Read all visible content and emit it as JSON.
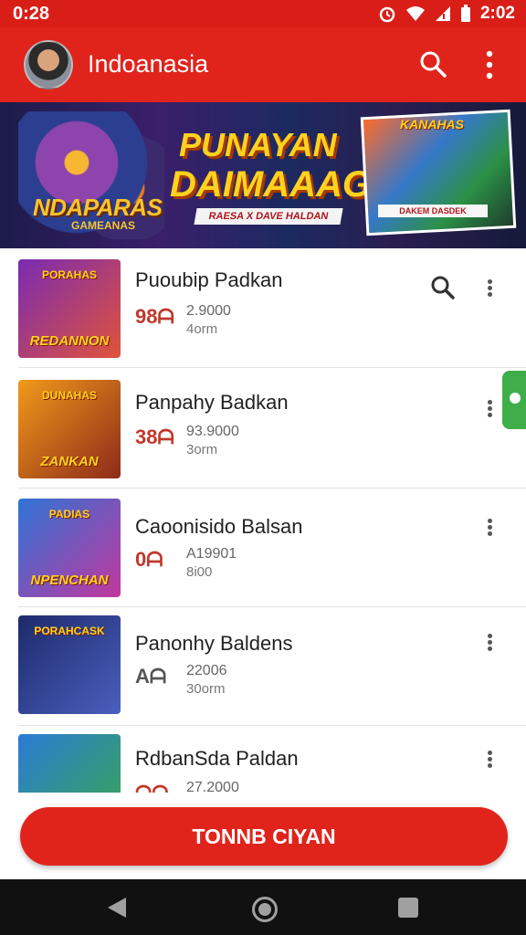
{
  "status_bar": {
    "time": "0:28",
    "battery_time": "2:02"
  },
  "app_bar": {
    "title": "Indoanasia",
    "icons": [
      "avatar",
      "search-icon",
      "more-vert-icon"
    ]
  },
  "banner": {
    "left_title": "NDAPARAS",
    "left_subtitle": "GAMEANAS",
    "main_line1": "PUNAYAN",
    "main_line2": "DAIMAAAG",
    "sub_text": "RAESA X DAVE HALDAN",
    "card_title": "KANAHAS",
    "card_sub": "DAKEM DASDEK"
  },
  "list": {
    "items": [
      {
        "title": "Puoubip Padkan",
        "stat_icon": "98ᗩ",
        "stat1": "2.9000",
        "stat2": "4orm",
        "thumb_top": "PORAHAS",
        "thumb_label": "REDANNON",
        "colors": [
          "#7a2bb3",
          "#e0533a"
        ]
      },
      {
        "title": "Panpahy Badkan",
        "stat_icon": "38ᗩ",
        "stat1": "93.9000",
        "stat2": "3orm",
        "thumb_top": "DUNAHAS",
        "thumb_label": "ZANKAN",
        "colors": [
          "#f09a1a",
          "#8e2a1a"
        ]
      },
      {
        "title": "Caoonisido Balsan",
        "stat_icon": "0ᗩ",
        "stat1": "A19901",
        "stat2": "8i00",
        "thumb_top": "PADIAS",
        "thumb_label": "NPENCHAN",
        "colors": [
          "#2f74d6",
          "#c2379e"
        ]
      },
      {
        "title": "Panonhy Baldens",
        "stat_icon": "Aᗩ",
        "stat1": "22006",
        "stat2": "30orm",
        "thumb_top": "PORAHCASK",
        "thumb_label": "",
        "colors": [
          "#1d2a6b",
          "#4a5fbd"
        ]
      },
      {
        "title": "RdbanSda Paldan",
        "stat_icon": "ᗩᗩ",
        "stat1": "27.2000",
        "stat2": "",
        "thumb_top": "",
        "thumb_label": "",
        "colors": [
          "#2a7bd6",
          "#3aa74e"
        ]
      }
    ]
  },
  "cta": {
    "label": "TONNB CIYAN"
  },
  "colors": {
    "primary": "#e0241c",
    "status": "#d91e18",
    "side_tab": "#3fae49"
  }
}
